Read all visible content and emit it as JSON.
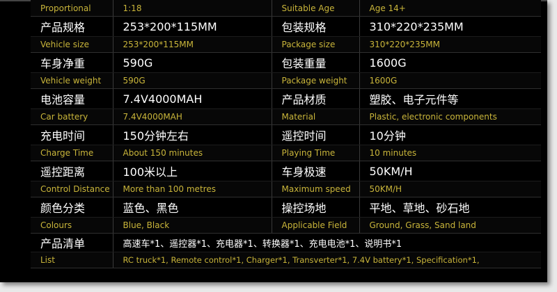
{
  "rows": [
    {
      "type": "en",
      "l1": "Proportional",
      "v1": "1:18",
      "l2": "Suitable Age",
      "v2": "Age 14+"
    },
    {
      "type": "cn",
      "l1": "产品规格",
      "v1": "253*200*115MM",
      "l2": "包装规格",
      "v2": "310*220*235MM"
    },
    {
      "type": "en",
      "l1": "Vehicle size",
      "v1": "253*200*115MM",
      "l2": "Package size",
      "v2": "310*220*235MM"
    },
    {
      "type": "cn",
      "l1": "车身净重",
      "v1": "590G",
      "l2": "包装重量",
      "v2": "1600G"
    },
    {
      "type": "en",
      "l1": "Vehicle weight",
      "v1": "590G",
      "l2": "Package weight",
      "v2": "1600G"
    },
    {
      "type": "cn",
      "l1": "电池容量",
      "v1": "7.4V4000MAH",
      "l2": "产品材质",
      "v2": "塑胶、电子元件等"
    },
    {
      "type": "en",
      "l1": "Car battery",
      "v1": "7.4V4000MAH",
      "l2": "Material",
      "v2": "Plastic, electronic components"
    },
    {
      "type": "cn",
      "l1": "充电时间",
      "v1": "150分钟左右",
      "l2": "遥控时间",
      "v2": "10分钟"
    },
    {
      "type": "en",
      "l1": "Charge Time",
      "v1": "About 150 minutes",
      "l2": "Playing Time",
      "v2": "10 minutes"
    },
    {
      "type": "cn",
      "l1": "遥控距离",
      "v1": "100米以上",
      "l2": "车身极速",
      "v2": "50KM/H"
    },
    {
      "type": "en",
      "l1": "Control Distance",
      "v1": "More than 100 metres",
      "l2": "Maximum speed",
      "v2": "50KM/H"
    },
    {
      "type": "cn",
      "l1": "颜色分类",
      "v1": "蓝色、黑色",
      "l2": "操控场地",
      "v2": "平地、草地、砂石地"
    },
    {
      "type": "en",
      "l1": "Colours",
      "v1": "Blue, Black",
      "l2": "Applicable Field",
      "v2": "Ground, Grass, Sand land"
    }
  ],
  "list_cn": {
    "label": "产品清单",
    "value": "高速车*1、遥控器*1、充电器*1、转换器*1、充电电池*1、说明书*1"
  },
  "list_en": {
    "label": "List",
    "value": "RC truck*1, Remote control*1,  Charger*1, Transverter*1, 7.4V  battery*1,  Specification*1,"
  }
}
